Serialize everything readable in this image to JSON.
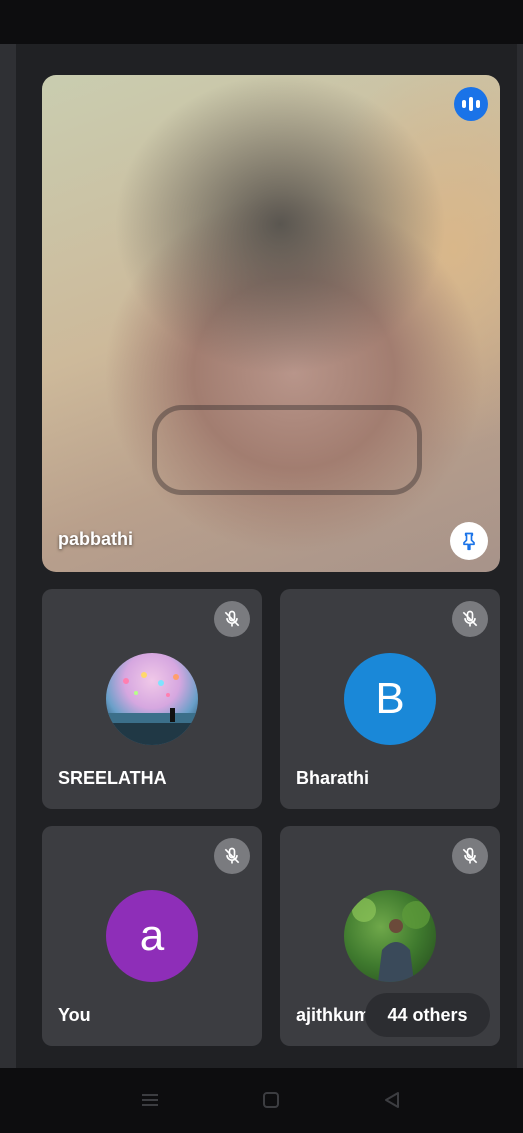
{
  "main_participant": {
    "name": "pabbathi",
    "speaking_icon": "audio-level-icon",
    "pin_icon": "pin-icon"
  },
  "participants": [
    {
      "name": "SREELATHA",
      "avatar_type": "photo",
      "mic_icon": "mic-off-icon"
    },
    {
      "name": "Bharathi",
      "avatar_type": "letter",
      "initial": "B",
      "avatar_color": "#1a88d8",
      "mic_icon": "mic-off-icon"
    },
    {
      "name": "You",
      "avatar_type": "letter",
      "initial": "a",
      "avatar_color": "#8e2eb8",
      "mic_icon": "mic-off-icon"
    },
    {
      "name": "ajithkum",
      "avatar_type": "photo",
      "mic_icon": "mic-off-icon"
    }
  ],
  "others": {
    "label": "44 others"
  },
  "navigation": {
    "icons": [
      "menu-icon",
      "home-icon",
      "back-icon"
    ]
  },
  "colors": {
    "background": "#202124",
    "tile": "#3c3d41",
    "accent": "#1a73e8"
  }
}
